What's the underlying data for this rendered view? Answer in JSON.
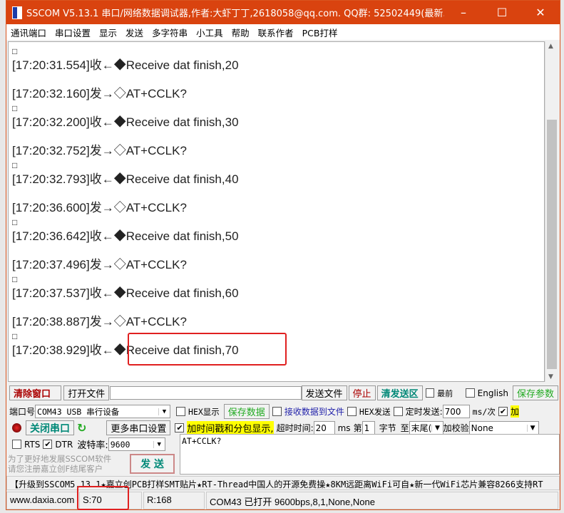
{
  "window": {
    "title": "SSCOM V5.13.1 串口/网络数据调试器,作者:大虾丁丁,2618058@qq.com. QQ群: 52502449(最新...",
    "minimize": "–",
    "maximize": "☐",
    "close": "✕"
  },
  "menu": [
    "通讯端口",
    "串口设置",
    "显示",
    "发送",
    "多字符串",
    "小工具",
    "帮助",
    "联系作者",
    "PCB打样"
  ],
  "log": [
    "□",
    "[17:20:31.554]收←◆Receive dat finish,20",
    "",
    "[17:20:32.160]发→◇AT+CCLK?",
    "□",
    "[17:20:32.200]收←◆Receive dat finish,30",
    "",
    "[17:20:32.752]发→◇AT+CCLK?",
    "□",
    "[17:20:32.793]收←◆Receive dat finish,40",
    "",
    "[17:20:36.600]发→◇AT+CCLK?",
    "□",
    "[17:20:36.642]收←◆Receive dat finish,50",
    "",
    "[17:20:37.496]发→◇AT+CCLK?",
    "□",
    "[17:20:37.537]收←◆Receive dat finish,60",
    "",
    "[17:20:38.887]发→◇AT+CCLK?",
    "□",
    "[17:20:38.929]收←◆Receive dat finish,70"
  ],
  "toolbar": {
    "clear": "清除窗口",
    "open_file": "打开文件",
    "file_path": "",
    "send_file": "发送文件",
    "stop": "停止",
    "clear_send": "清发送区",
    "topmost": "最前",
    "english": "English",
    "save_params": "保存参数"
  },
  "port": {
    "label": "端口号",
    "value": "COM43 USB 串行设备",
    "close_port": "关闭串口",
    "more": "更多串口设置",
    "rts": "RTS",
    "dtr": "DTR",
    "baud_label": "波特率:",
    "baud": "9600",
    "promo": "为了更好地发展SSCOM软件\n请您注册嘉立创F结尾客户",
    "send": "发  送"
  },
  "options": {
    "hex_display": "HEX显示",
    "save_data": "保存数据",
    "recv_to_file": "接收数据到文件",
    "hex_send": "HEX发送",
    "timed_send": "定时发送:",
    "interval": "700",
    "unit": "ms/次",
    "add": "加",
    "timestamp": "加时间戳和分包显示,",
    "timeout_label": "超时时间:",
    "timeout": "20",
    "ms": "ms",
    "byte_prefix": "第",
    "byte_no": "1",
    "byte_suffix": "字节",
    "to": "至",
    "end": "末尾(",
    "checksum_label": "加校验",
    "checksum": "None"
  },
  "send_text": "AT+CCLK?",
  "ticker": "【升级到SSCOM5.13.1★嘉立创PCB打样SMT贴片★RT-Thread中国人的开源免费操★8KM远距离WiFi可自★新一代WiFi芯片兼容8266支持RT",
  "status": {
    "site": "www.daxia.com",
    "sent": "S:70",
    "received": "R:168",
    "port_state": "COM43 已打开  9600bps,8,1,None,None"
  },
  "colors": {
    "title_bar": "#d9430f",
    "highlight": "#e02020"
  }
}
